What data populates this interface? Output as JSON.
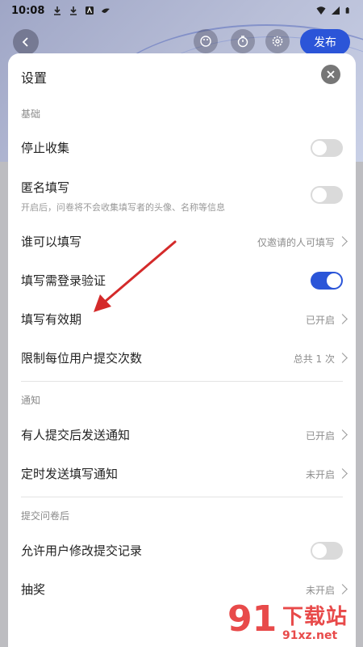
{
  "status_bar": {
    "time": "10:08"
  },
  "app_bar": {
    "publish_label": "发布"
  },
  "dialog": {
    "title": "设置",
    "sections": {
      "basic": "基础",
      "notify": "通知",
      "after_submit": "提交问卷后"
    },
    "rows": {
      "stop_collect": {
        "label": "停止收集",
        "toggle_on": false
      },
      "anonymous": {
        "label": "匿名填写",
        "sub": "开启后，问卷将不会收集填写者的头像、名称等信息",
        "toggle_on": false
      },
      "who_can_fill": {
        "label": "谁可以填写",
        "value": "仅邀请的人可填写"
      },
      "login_required": {
        "label": "填写需登录验证",
        "toggle_on": true
      },
      "validity": {
        "label": "填写有效期",
        "value": "已开启"
      },
      "limit_submit": {
        "label": "限制每位用户提交次数",
        "value": "总共 1 次"
      },
      "notify_on_submit": {
        "label": "有人提交后发送通知",
        "value": "已开启"
      },
      "scheduled_notify": {
        "label": "定时发送填写通知",
        "value": "未开启"
      },
      "allow_edit": {
        "label": "允许用户修改提交记录",
        "toggle_on": false
      },
      "lottery": {
        "label": "抽奖",
        "value": "未开启"
      }
    }
  },
  "watermark": {
    "number": "91",
    "text": "下载站",
    "url": "91xz.net"
  },
  "colors": {
    "accent": "#2b55d8",
    "annotation_arrow": "#d42a2a",
    "watermark": "#e84a4a"
  }
}
